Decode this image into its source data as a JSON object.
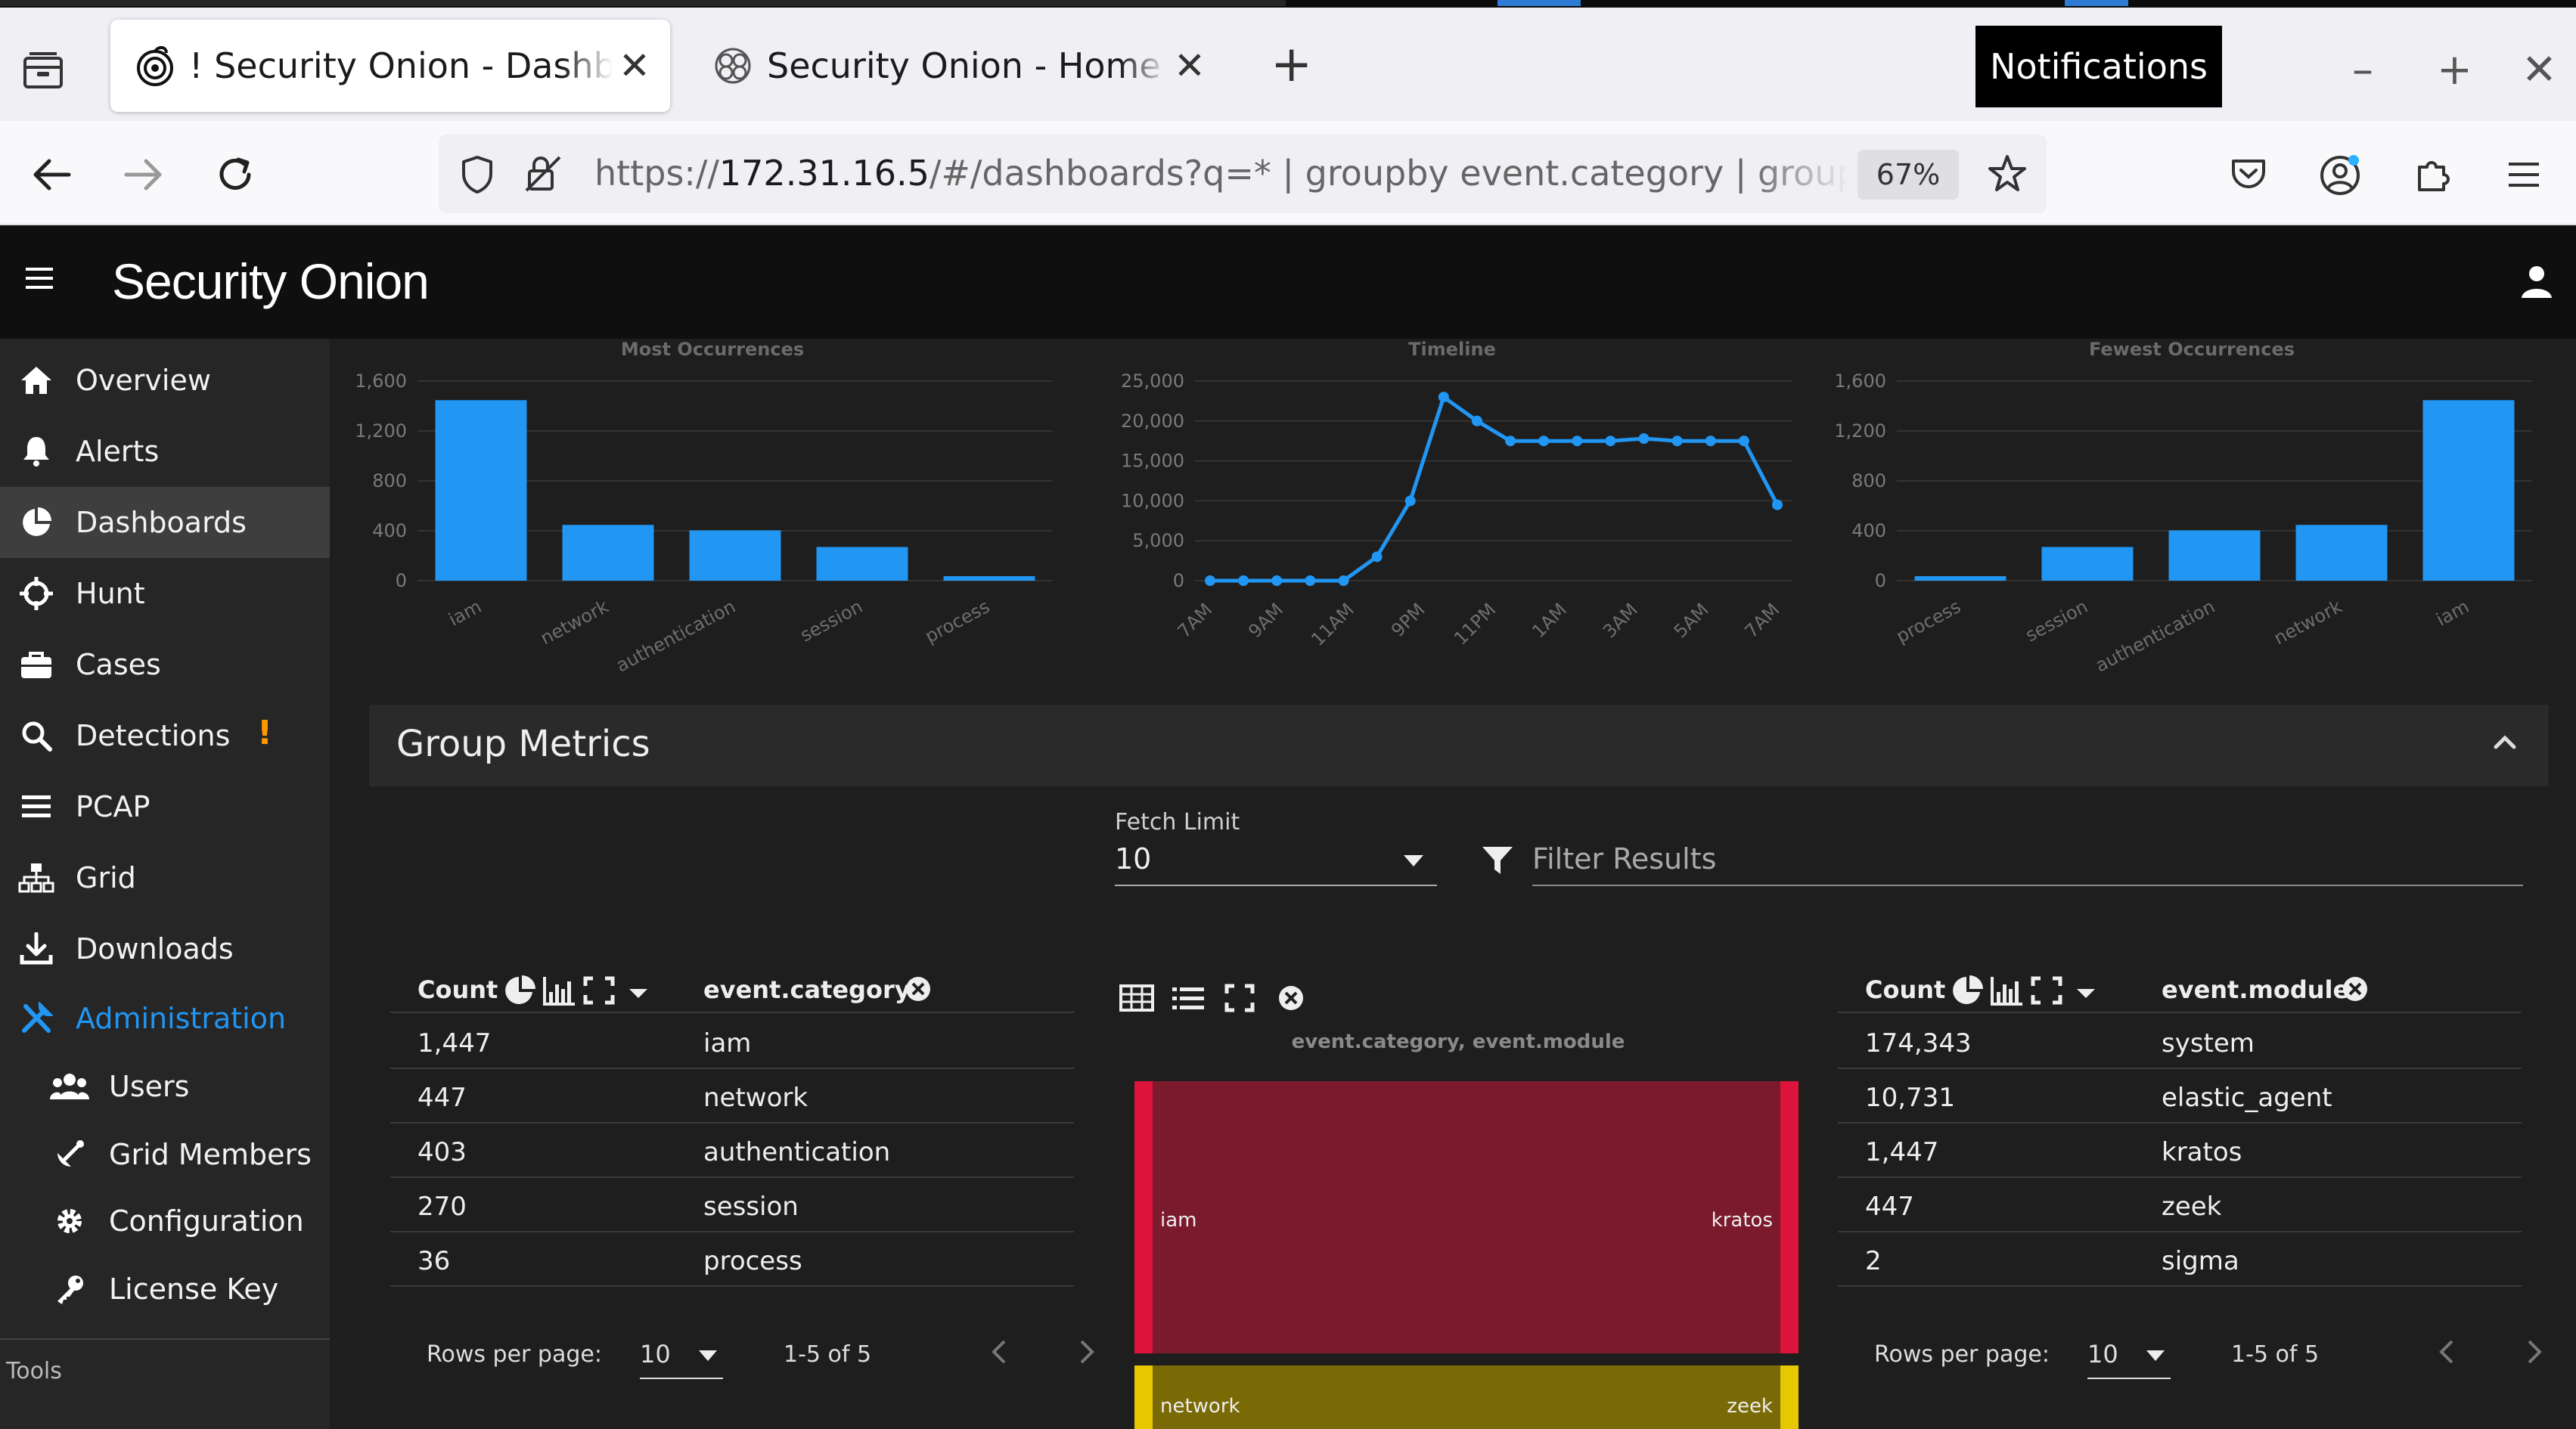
{
  "browser": {
    "tabs": [
      {
        "title": "! Security Onion - Dashboards",
        "active": true
      },
      {
        "title": "Security Onion - Home - Elastic",
        "active": false
      }
    ],
    "notifications_tooltip": "Notifications",
    "url_prefix": "https://",
    "url_host": "172.31.16.5",
    "url_rest": "/#/dashboards?q=* | groupby event.category | groupby event.module",
    "zoom": "67%"
  },
  "app": {
    "brand": "Security Onion",
    "sidebar": {
      "items": [
        {
          "label": "Overview",
          "icon": "home-icon"
        },
        {
          "label": "Alerts",
          "icon": "bell-icon"
        },
        {
          "label": "Dashboards",
          "icon": "pie-chart-icon",
          "active": true
        },
        {
          "label": "Hunt",
          "icon": "crosshairs-icon"
        },
        {
          "label": "Cases",
          "icon": "briefcase-icon"
        },
        {
          "label": "Detections",
          "icon": "search-icon",
          "badge": "!"
        },
        {
          "label": "PCAP",
          "icon": "list-icon"
        },
        {
          "label": "Grid",
          "icon": "sitemap-icon"
        },
        {
          "label": "Downloads",
          "icon": "download-icon"
        },
        {
          "label": "Administration",
          "icon": "tools-icon"
        }
      ],
      "sub_items": [
        {
          "label": "Users",
          "icon": "users-icon"
        },
        {
          "label": "Grid Members",
          "icon": "satellite-icon"
        },
        {
          "label": "Configuration",
          "icon": "gear-icon"
        },
        {
          "label": "License Key",
          "icon": "key-icon"
        }
      ],
      "tools_label": "Tools"
    }
  },
  "charts": {
    "most": {
      "title": "Most Occurrences",
      "type": "bar",
      "categories": [
        "iam",
        "network",
        "authentication",
        "session",
        "process"
      ],
      "values": [
        1447,
        447,
        403,
        270,
        36
      ],
      "yticks": [
        "0",
        "400",
        "800",
        "1,200",
        "1,600"
      ],
      "ylim": [
        0,
        1600
      ]
    },
    "timeline": {
      "title": "Timeline",
      "type": "line",
      "xticks": [
        "7AM",
        "9AM",
        "11AM",
        "9PM",
        "11PM",
        "1AM",
        "3AM",
        "5AM",
        "7AM"
      ],
      "yticks": [
        "0",
        "5,000",
        "10,000",
        "15,000",
        "20,000",
        "25,000"
      ],
      "ylim": [
        0,
        25000
      ]
    },
    "fewest": {
      "title": "Fewest Occurrences",
      "type": "bar",
      "categories": [
        "process",
        "session",
        "authentication",
        "network",
        "iam"
      ],
      "values": [
        36,
        270,
        403,
        447,
        1447
      ],
      "yticks": [
        "0",
        "400",
        "800",
        "1,200",
        "1,600"
      ],
      "ylim": [
        0,
        1600
      ]
    }
  },
  "chart_data": [
    {
      "type": "bar",
      "title": "Most Occurrences",
      "categories": [
        "iam",
        "network",
        "authentication",
        "session",
        "process"
      ],
      "values": [
        1447,
        447,
        403,
        270,
        36
      ],
      "ylim": [
        0,
        1600
      ]
    },
    {
      "type": "line",
      "title": "Timeline",
      "x": [
        "7AM",
        "8AM",
        "9AM",
        "10AM",
        "11AM",
        "8PM",
        "9PM",
        "10PM",
        "11PM",
        "12AM",
        "1AM",
        "2AM",
        "3AM",
        "4AM",
        "5AM",
        "6AM",
        "7AM",
        "8AM"
      ],
      "values": [
        0,
        0,
        0,
        0,
        0,
        3000,
        10000,
        23000,
        20000,
        17500,
        17500,
        17500,
        17500,
        17800,
        17500,
        17500,
        17500,
        9500
      ],
      "ylim": [
        0,
        25000
      ]
    },
    {
      "type": "bar",
      "title": "Fewest Occurrences",
      "categories": [
        "process",
        "session",
        "authentication",
        "network",
        "iam"
      ],
      "values": [
        36,
        270,
        403,
        447,
        1447
      ],
      "ylim": [
        0,
        1600
      ]
    }
  ],
  "group_metrics": {
    "title": "Group Metrics",
    "fetch_limit_label": "Fetch Limit",
    "fetch_limit_value": "10",
    "filter_placeholder": "Filter Results",
    "left_table": {
      "count_header": "Count",
      "field_header": "event.category",
      "rows": [
        {
          "count": "1,447",
          "value": "iam"
        },
        {
          "count": "447",
          "value": "network"
        },
        {
          "count": "403",
          "value": "authentication"
        },
        {
          "count": "270",
          "value": "session"
        },
        {
          "count": "36",
          "value": "process"
        }
      ],
      "rows_per_page_label": "Rows per page:",
      "rows_per_page_value": "10",
      "range": "1-5 of 5"
    },
    "right_table": {
      "count_header": "Count",
      "field_header": "event.module",
      "rows": [
        {
          "count": "174,343",
          "value": "system"
        },
        {
          "count": "10,731",
          "value": "elastic_agent"
        },
        {
          "count": "1,447",
          "value": "kratos"
        },
        {
          "count": "447",
          "value": "zeek"
        },
        {
          "count": "2",
          "value": "sigma"
        }
      ],
      "rows_per_page_label": "Rows per page:",
      "rows_per_page_value": "10",
      "range": "1-5 of 5"
    },
    "sankey": {
      "title": "event.category, event.module",
      "flows": [
        {
          "from": "iam",
          "to": "kratos",
          "value": 1447,
          "color": "#7b1a2d",
          "edge": "#dc143c"
        },
        {
          "from": "network",
          "to": "zeek",
          "value": 447,
          "color": "#7a6a06",
          "edge": "#e6c800"
        }
      ]
    }
  },
  "colors": {
    "accent": "#2196f3",
    "bar": "#2196f3",
    "warning": "#ff9800",
    "background": "#1e1e1e",
    "sidebar": "#262626"
  }
}
